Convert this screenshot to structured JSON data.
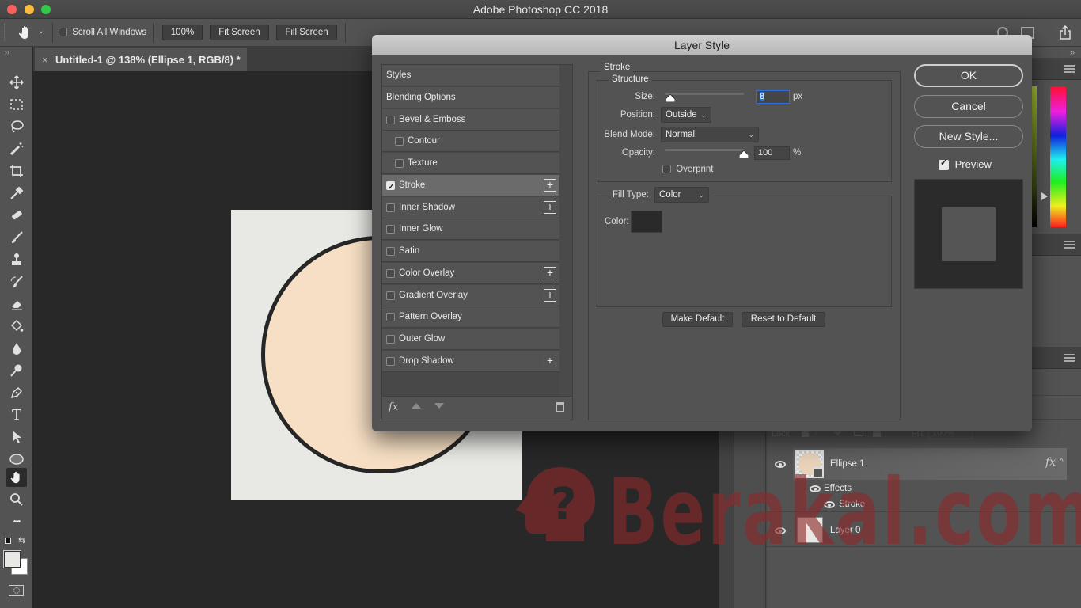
{
  "window": {
    "title": "Adobe Photoshop CC 2018",
    "traffic_lights": [
      "close",
      "minimize",
      "zoom"
    ]
  },
  "options_bar": {
    "active_tool_icon": "hand-icon",
    "scroll_all_windows_label": "Scroll All Windows",
    "scroll_all_windows_checked": false,
    "zoom_100_label": "100%",
    "fit_screen_label": "Fit Screen",
    "fill_screen_label": "Fill Screen",
    "right_icons": [
      "search-icon",
      "workspace-icon",
      "share-icon"
    ]
  },
  "document": {
    "tab_label": "Untitled-1 @ 138% (Ellipse 1, RGB/8) *",
    "close_glyph": "×",
    "colors": {
      "artboard": "#e8e8e4",
      "ellipse_fill": "#f6dfc4",
      "ellipse_stroke": "#262626"
    }
  },
  "toolbar": {
    "tools": [
      "move",
      "marquee",
      "lasso",
      "magic-wand",
      "crop",
      "eyedropper",
      "healing-brush",
      "brush",
      "clone-stamp",
      "history-brush",
      "eraser",
      "paint-bucket",
      "blur",
      "dodge",
      "pen",
      "type",
      "path-selection",
      "ellipse",
      "hand",
      "zoom",
      "more"
    ],
    "active_tool": "hand",
    "type_glyph": "T",
    "more_glyph": "•••"
  },
  "dialog": {
    "title": "Layer Style",
    "styles_list": [
      {
        "label": "Styles",
        "checkbox": null,
        "indent": 0,
        "plus": false,
        "selected": false
      },
      {
        "label": "Blending Options",
        "checkbox": null,
        "indent": 0,
        "plus": false,
        "selected": false
      },
      {
        "label": "Bevel & Emboss",
        "checkbox": false,
        "indent": 0,
        "plus": false,
        "selected": false
      },
      {
        "label": "Contour",
        "checkbox": false,
        "indent": 1,
        "plus": false,
        "selected": false
      },
      {
        "label": "Texture",
        "checkbox": false,
        "indent": 1,
        "plus": false,
        "selected": false
      },
      {
        "label": "Stroke",
        "checkbox": true,
        "indent": 0,
        "plus": true,
        "selected": true
      },
      {
        "label": "Inner Shadow",
        "checkbox": false,
        "indent": 0,
        "plus": true,
        "selected": false
      },
      {
        "label": "Inner Glow",
        "checkbox": false,
        "indent": 0,
        "plus": false,
        "selected": false
      },
      {
        "label": "Satin",
        "checkbox": false,
        "indent": 0,
        "plus": false,
        "selected": false
      },
      {
        "label": "Color Overlay",
        "checkbox": false,
        "indent": 0,
        "plus": true,
        "selected": false
      },
      {
        "label": "Gradient Overlay",
        "checkbox": false,
        "indent": 0,
        "plus": true,
        "selected": false
      },
      {
        "label": "Pattern Overlay",
        "checkbox": false,
        "indent": 0,
        "plus": false,
        "selected": false
      },
      {
        "label": "Outer Glow",
        "checkbox": false,
        "indent": 0,
        "plus": false,
        "selected": false
      },
      {
        "label": "Drop Shadow",
        "checkbox": false,
        "indent": 0,
        "plus": true,
        "selected": false
      }
    ],
    "list_footer": {
      "fx_label": "fx",
      "icons": [
        "fx-icon",
        "move-up-icon",
        "move-down-icon",
        "trash-icon"
      ]
    },
    "stroke": {
      "section_title": "Stroke",
      "structure_title": "Structure",
      "size_label": "Size:",
      "size_value": "8",
      "size_unit": "px",
      "size_slider_fraction": 0.03,
      "position_label": "Position:",
      "position_value": "Outside",
      "blend_mode_label": "Blend Mode:",
      "blend_mode_value": "Normal",
      "opacity_label": "Opacity:",
      "opacity_value": "100",
      "opacity_unit": "%",
      "opacity_slider_fraction": 1.0,
      "overprint_label": "Overprint",
      "overprint_checked": false,
      "fill_type_label": "Fill Type:",
      "fill_type_value": "Color",
      "color_label": "Color:",
      "color_value": "#2a2a2a",
      "make_default_label": "Make Default",
      "reset_default_label": "Reset to Default"
    },
    "buttons": {
      "ok_label": "OK",
      "cancel_label": "Cancel",
      "new_style_label": "New Style...",
      "preview_label": "Preview",
      "preview_checked": true
    }
  },
  "layers_panel": {
    "lock_label": "Lock:",
    "fill_label": "Fill:",
    "fill_value": "100%",
    "layers": [
      {
        "name": "Ellipse 1",
        "visible": true,
        "has_fx": true,
        "fx_label": "fx",
        "selected": true
      },
      {
        "name": "Layer 0",
        "visible": true,
        "has_fx": false,
        "selected": false
      }
    ],
    "effects_label": "Effects",
    "effects": [
      "Stroke"
    ]
  },
  "watermark": {
    "text": "Berakal.com",
    "color": "#8c2828"
  }
}
